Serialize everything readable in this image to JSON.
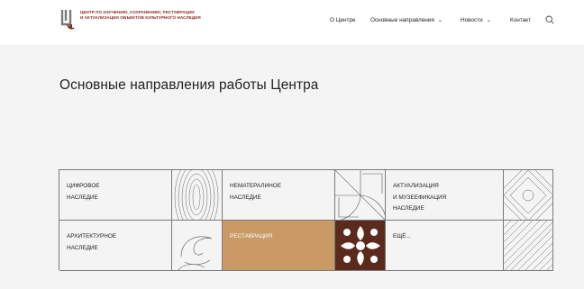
{
  "header": {
    "logo_line1": "ЦЕНТР ПО ИЗУЧЕНИЮ, СОХРАНЕНИЮ, РЕСТАВРАЦИИ",
    "logo_line2": "И АКТУАЛИЗАЦИИ ОБЪЕКТОВ КУЛЬТУРНОГО НАСЛЕДИЯ",
    "nav": [
      {
        "label": "О Центре"
      },
      {
        "label": "Основные направления",
        "chevron": "chevron-down-icon"
      },
      {
        "label": "Новости",
        "chevron": "chevron-down-icon"
      },
      {
        "label": "Контакт"
      }
    ],
    "search_icon": "search-icon"
  },
  "main": {
    "title": "Основные направления работы Центра"
  },
  "directions": [
    {
      "line1": "ЦИФРОВОЕ",
      "line2": "НАСЛЕДИЕ",
      "line3": ""
    },
    {
      "line1": "НЕМАТЕРАЛИНОЕ",
      "line2": "НАСЛЕДИЕ",
      "line3": ""
    },
    {
      "line1": "АКТУАЛИЗАЦИЯ",
      "line2": "И МУЗЕЕФИКАЦИЯ",
      "line3": "НАСЛЕДИЕ"
    },
    {
      "line1": "АРХИТЕКТУРНОЕ",
      "line2": "НАСЛЕДИЕ",
      "line3": ""
    },
    {
      "line1": "РЕСТАВРАЦИЯ",
      "line2": "",
      "line3": ""
    },
    {
      "line1": "ЕЩЁ...",
      "line2": "",
      "line3": ""
    }
  ],
  "colors": {
    "accent": "#c99a66",
    "brand": "#8a2a22",
    "ornament_bg": "#5a2a1c",
    "background": "#f4f4f4"
  }
}
